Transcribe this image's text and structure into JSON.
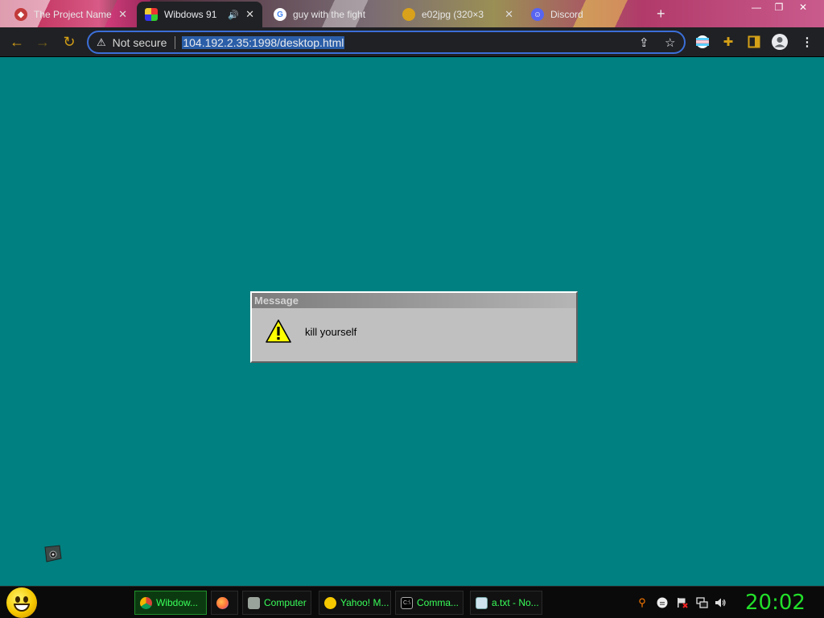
{
  "browser": {
    "tabs": [
      {
        "title": "The Project Name",
        "favicon": "custom-favicon-icon"
      },
      {
        "title": "Wibdows 91",
        "favicon": "wibdows-favicon-icon",
        "audio_icon": "🔊"
      },
      {
        "title": "guy with the fight",
        "favicon": "google-favicon-icon",
        "favicon_text": "G"
      },
      {
        "title": "e02jpg (320×3",
        "favicon": "image-favicon-icon"
      },
      {
        "title": "Discord",
        "favicon": "discord-favicon-icon"
      }
    ],
    "close_glyph": "✕",
    "new_tab_glyph": "+",
    "window_controls": {
      "minimize": "—",
      "maximize": "❐",
      "close": "✕"
    },
    "nav": {
      "back": "←",
      "forward": "→",
      "reload": "↻"
    },
    "omnibox": {
      "security_icon": "⚠",
      "security_label": "Not secure",
      "url": "104.192.2.35:1998/desktop.html",
      "share_icon": "⇪",
      "bookmark_icon": "☆"
    },
    "extensions": {
      "menu_icon": "⋮"
    }
  },
  "dialog": {
    "title": "Message",
    "message": "kill yourself",
    "icon": "warning-icon"
  },
  "taskbar": {
    "items": [
      {
        "label": "Wibdow...",
        "icon": "chrome-icon",
        "active": true
      },
      {
        "label": "",
        "icon": "firefox-icon",
        "active": false
      },
      {
        "label": "Computer",
        "icon": "computer-icon",
        "active": false
      },
      {
        "label": "Yahoo! M...",
        "icon": "yahoo-messenger-icon",
        "active": false
      },
      {
        "label": "Comma...",
        "icon": "command-prompt-icon",
        "active": false
      },
      {
        "label": "a.txt - No...",
        "icon": "notepad-icon",
        "active": false
      }
    ],
    "clock": "20:02"
  },
  "colors": {
    "desktop": "#008080",
    "clock": "#22e02a",
    "taskbar_text": "#39ff5a",
    "omnibox_focus": "#3b6fd8"
  }
}
